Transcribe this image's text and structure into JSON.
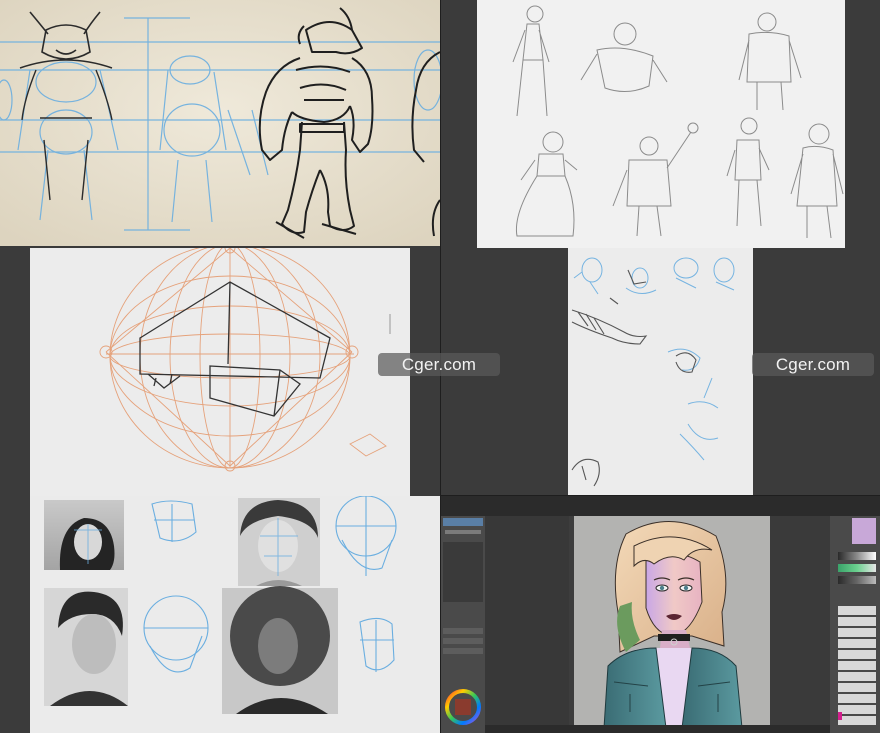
{
  "watermarks": [
    "Cger.com",
    "Cger.com"
  ],
  "panels": {
    "minotaur_sheet": {
      "label": "Minotaur construction sketch"
    },
    "figure_sketches": {
      "label": "Figure gesture sketches"
    },
    "perspective_grid": {
      "label": "Spherical perspective grid"
    },
    "bird_sketches": {
      "label": "Bird and dragon sketches"
    },
    "head_studies": {
      "label": "Head proportion studies"
    },
    "paint_app": {
      "label": "Digital painting application"
    }
  },
  "colors": {
    "paper_warm": "#ece6d6",
    "sketch_blue": "#6aaee0",
    "sketch_orange": "#e59a6f",
    "ink": "#2a2a2a",
    "app_dark": "#3d3d3d",
    "canvas_gray": "#b3b3b1"
  }
}
